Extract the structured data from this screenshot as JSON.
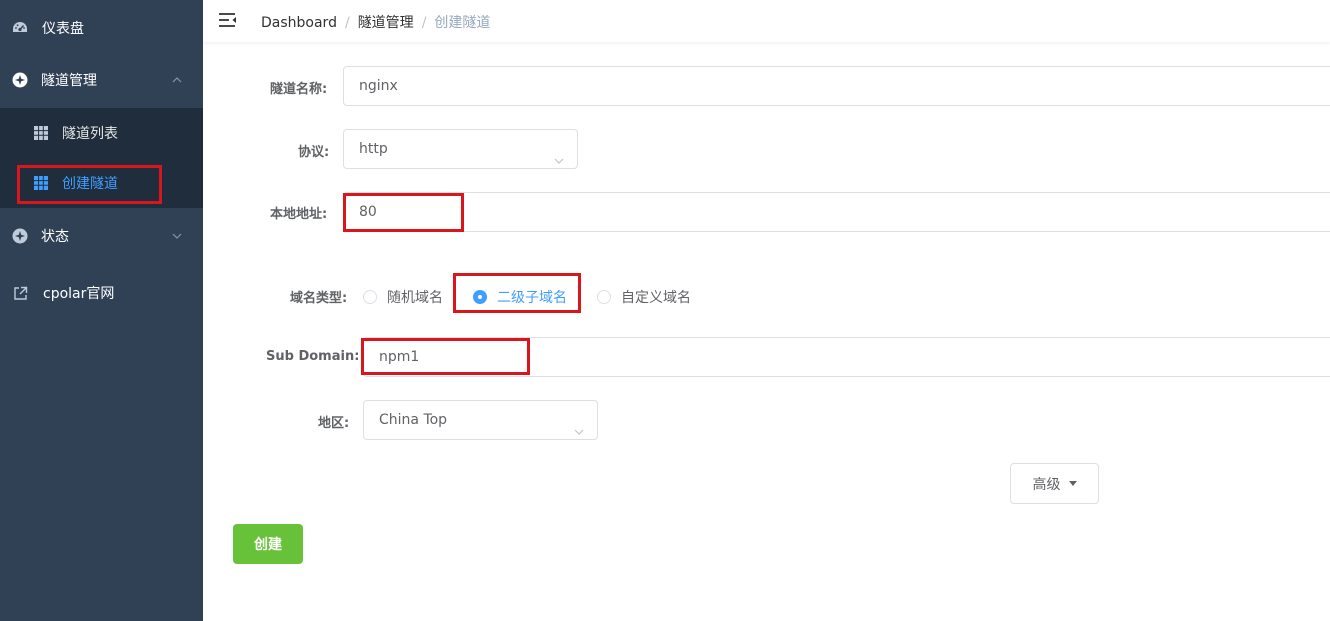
{
  "sidebar": {
    "items": [
      {
        "label": "仪表盘",
        "icon": "dashboard-icon"
      },
      {
        "label": "隧道管理",
        "icon": "tunnel-icon",
        "expanded": true
      },
      {
        "label": "状态",
        "icon": "status-icon"
      },
      {
        "label": "cpolar官网",
        "icon": "external-link-icon"
      }
    ],
    "submenu": [
      {
        "label": "隧道列表",
        "icon": "grid-icon"
      },
      {
        "label": "创建隧道",
        "icon": "grid-icon",
        "active": true
      }
    ]
  },
  "breadcrumb": {
    "items": [
      "Dashboard",
      "隧道管理",
      "创建隧道"
    ],
    "separator": "/"
  },
  "form": {
    "tunnel_name": {
      "label": "隧道名称:",
      "value": "nginx"
    },
    "protocol": {
      "label": "协议:",
      "value": "http"
    },
    "local_address": {
      "label": "本地地址:",
      "value": "80"
    },
    "domain_type": {
      "label": "域名类型:",
      "options": [
        "随机域名",
        "二级子域名",
        "自定义域名"
      ],
      "selected": "二级子域名"
    },
    "sub_domain": {
      "label": "Sub Domain:",
      "value": "npm1"
    },
    "region": {
      "label": "地区:",
      "value": "China Top"
    },
    "advanced_label": "高级",
    "create_label": "创建"
  },
  "colors": {
    "sidebar_bg": "#304156",
    "submenu_bg": "#1f2d3d",
    "active": "#409eff",
    "create_button": "#67c23a",
    "highlight_box": "#d9161c"
  }
}
